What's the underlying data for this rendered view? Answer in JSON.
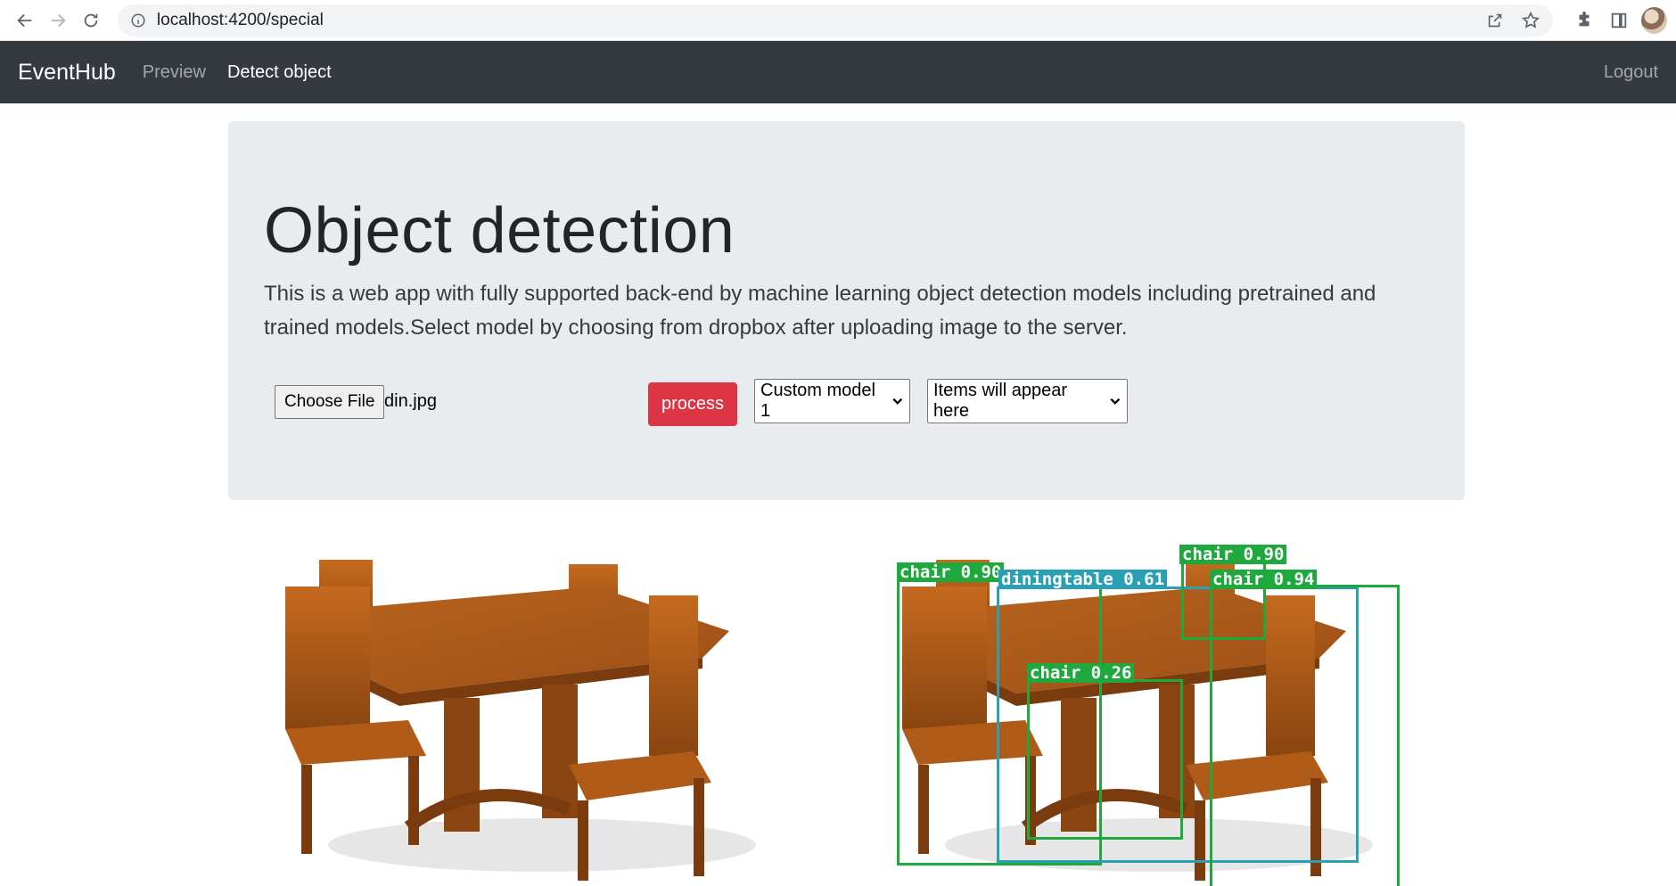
{
  "browser": {
    "url": "localhost:4200/special"
  },
  "navbar": {
    "brand": "EventHub",
    "links": [
      {
        "label": "Preview",
        "active": false
      },
      {
        "label": "Detect object",
        "active": true
      }
    ],
    "logout": "Logout",
    "bg_color": "#343a40"
  },
  "jumbotron": {
    "title": "Object detection",
    "description": "This is a web app with fully supported back-end by machine learning object detection models including pretrained and trained models.Select model by choosing from dropbox after uploading image to the server."
  },
  "controls": {
    "choose_file_label": "Choose File",
    "file_name": "din.jpg",
    "process_label": "process",
    "process_color": "#dc3545",
    "model_select_value": "Custom model 1",
    "items_select_value": "Items will appear here"
  },
  "detections": [
    {
      "label": "chair 0.90",
      "color": "#1fa83d"
    },
    {
      "label": "diningtable 0.61",
      "color": "#2aa0b5"
    },
    {
      "label": "chair 0.90",
      "color": "#1fa83d"
    },
    {
      "label": "chair 0.94",
      "color": "#1fa83d"
    },
    {
      "label": "chair 0.26",
      "color": "#1fa83d"
    }
  ]
}
